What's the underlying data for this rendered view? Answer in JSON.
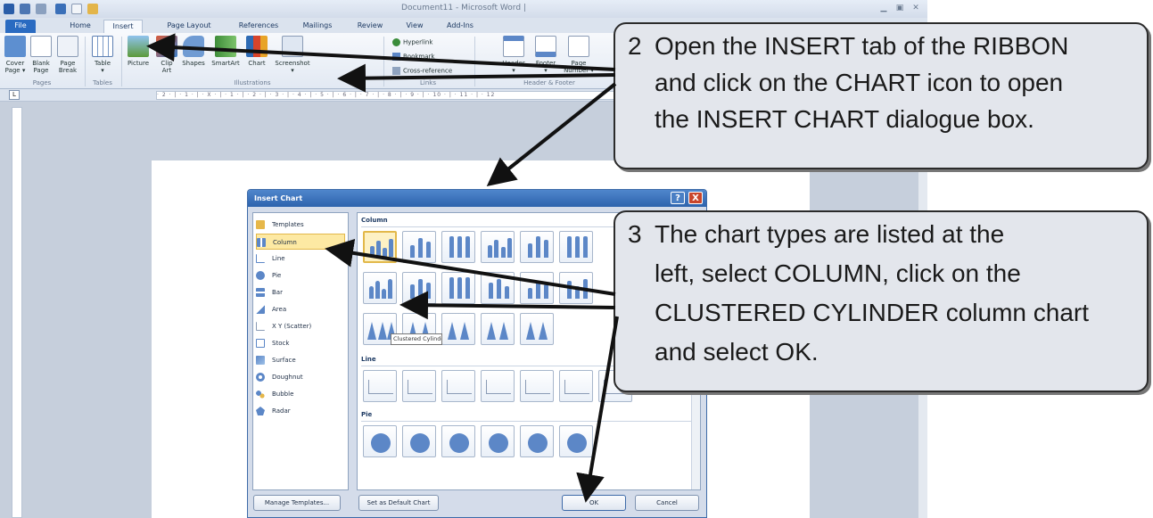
{
  "window": {
    "title": "Document11 - Microsoft Word |",
    "controls": [
      "minimize",
      "restore",
      "close"
    ]
  },
  "ribbon_tabs": [
    "File",
    "Home",
    "Insert",
    "Page Layout",
    "References",
    "Mailings",
    "Review",
    "View",
    "Add-Ins"
  ],
  "ribbon": {
    "pages": {
      "buttons": [
        [
          "Cover",
          "Page ▾"
        ],
        [
          "Blank",
          "Page"
        ],
        [
          "Page",
          "Break"
        ]
      ],
      "group_label": "Pages"
    },
    "tables": {
      "buttons": [
        [
          "Table",
          "▾"
        ]
      ],
      "group_label": "Tables"
    },
    "illustrations": {
      "buttons": [
        [
          "Picture",
          ""
        ],
        [
          "Clip",
          "Art"
        ],
        [
          "Shapes",
          ""
        ],
        [
          "SmartArt",
          ""
        ],
        [
          "Chart",
          ""
        ],
        [
          "Screenshot",
          "▾"
        ]
      ],
      "group_label": "Illustrations"
    },
    "links": {
      "buttons": [
        "Hyperlink",
        "Bookmark",
        "Cross-reference"
      ],
      "group_label": "Links"
    },
    "header_footer": {
      "buttons": [
        [
          "Header",
          "▾"
        ],
        [
          "Footer",
          "▾"
        ],
        [
          "Page",
          "Number ▾"
        ]
      ],
      "group_label": "Header & Footer"
    }
  },
  "ruler_text": "· 2 · | · 1 · | · X · | · 1 · | · 2 · | · 3 · | · 4 · | · 5 · | · 6 · | · 7 · | · 8 · | · 9 · | · 10 · | · 11 · | · 12",
  "dialog": {
    "title": "Insert Chart",
    "help_button": "?",
    "close_button": "X",
    "chart_types": [
      "Templates",
      "Column",
      "Line",
      "Pie",
      "Bar",
      "Area",
      "X Y (Scatter)",
      "Stock",
      "Surface",
      "Doughnut",
      "Bubble",
      "Radar"
    ],
    "selected_type": "Column",
    "sections": {
      "column": "Column",
      "line": "Line",
      "pie": "Pie"
    },
    "tooltip": "Clustered Cylinder",
    "manage_templates": "Manage Templates...",
    "set_default": "Set as Default Chart",
    "ok": "OK",
    "cancel": "Cancel"
  },
  "callouts": {
    "step2": {
      "number": "2",
      "lines": [
        "Open the INSERT tab of the RIBBON",
        "and click on the CHART icon to open",
        "the INSERT CHART dialogue box."
      ]
    },
    "step3": {
      "number": "3",
      "lines": [
        "The chart types are listed at the",
        "left, select COLUMN, click on the",
        "CLUSTERED CYLINDER column chart",
        "and select OK."
      ]
    }
  },
  "colors": {
    "file_tab": "#2a6bc1",
    "dialog_title": "#2d63ad",
    "selection": "#fde9a3",
    "callout_bg": "#e3e6ec",
    "arrow": "#111111"
  }
}
